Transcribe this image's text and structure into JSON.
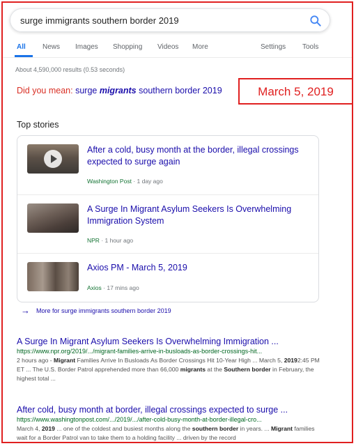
{
  "search": {
    "query": "surge immigrants southern border 2019"
  },
  "tabs": [
    "All",
    "News",
    "Images",
    "Shopping",
    "Videos",
    "More",
    "Settings",
    "Tools"
  ],
  "result_stats": "About 4,590,000 results (0.53 seconds)",
  "did_you_mean": {
    "label": "Did you mean:",
    "pre": "surge ",
    "bold": "migrants",
    "post": " southern border 2019"
  },
  "date_annotation": "March 5, 2019",
  "top_stories": {
    "title": "Top stories",
    "items": [
      {
        "title": "After a cold, busy month at the border, illegal crossings expected to surge again",
        "source": "Washington Post",
        "time": "1 day ago"
      },
      {
        "title": "A Surge In Migrant Asylum Seekers Is Overwhelming Immigration System",
        "source": "NPR",
        "time": "1 hour ago"
      },
      {
        "title": "Axios PM - March 5, 2019",
        "source": "Axios",
        "time": "17 mins ago"
      }
    ],
    "more_label": "More for surge immigrants southern border 2019"
  },
  "results": [
    {
      "title": "A Surge In Migrant Asylum Seekers Is Overwhelming Immigration ...",
      "url": "https://www.npr.org/2019/.../migrant-families-arrive-in-busloads-as-border-crossings-hit...",
      "snippet_html": "2 hours ago - <b>Migrant</b> Families Arrive In Busloads As Border Crossings Hit 10-Year High ... March 5, <b>2019</b>2:45 PM ET ... The U.S. Border Patrol apprehended more than 66,000 <b>migrants</b> at the <b>Southern border</b> in February, the highest total ..."
    },
    {
      "title": "After cold, busy month at border, illegal crossings expected to surge ...",
      "url": "https://www.washingtonpost.com/.../2019/.../after-cold-busy-month-at-border-illegal-cro...",
      "snippet_html": "March 4, <b>2019</b> ... one of the coldest and busiest months along the <b>southern border</b> in years. ... <b>Migrant</b> families wait for a Border Patrol van to take them to a holding facility ... driven by the record"
    }
  ],
  "colors": {
    "annotation_red": "#e02020",
    "link": "#1a0dab",
    "accent": "#1a73e8",
    "source_green": "#137333"
  }
}
